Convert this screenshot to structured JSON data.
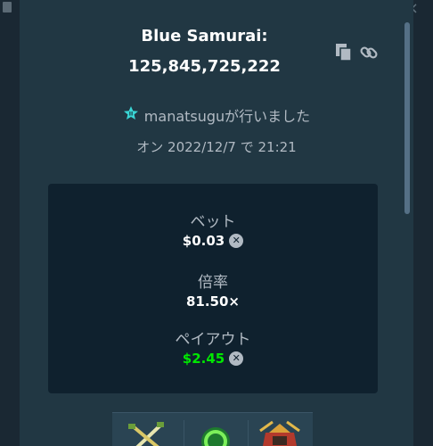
{
  "game": {
    "title_line1": "Blue Samurai:",
    "title_line2": "125,845,725,222"
  },
  "user_line": {
    "username_text": "manatsuguが行いました"
  },
  "date_line": "オン 2022/12/7 で 21:21",
  "stats": {
    "bet_label": "ベット",
    "bet_value": "$0.03",
    "multiplier_label": "倍率",
    "multiplier_value": "81.50×",
    "payout_label": "ペイアウト",
    "payout_value": "$2.45"
  },
  "colors": {
    "modal_bg": "#213743",
    "stats_bg": "#0f212e",
    "accent_green": "#00e701",
    "muted_text": "#b1bac3",
    "badge_cyan": "#3ad6d6"
  },
  "icons": {
    "copy": "copy-icon",
    "link": "link-icon",
    "vip_badge": "star-badge-icon",
    "currency": "xrp-coin-icon"
  }
}
